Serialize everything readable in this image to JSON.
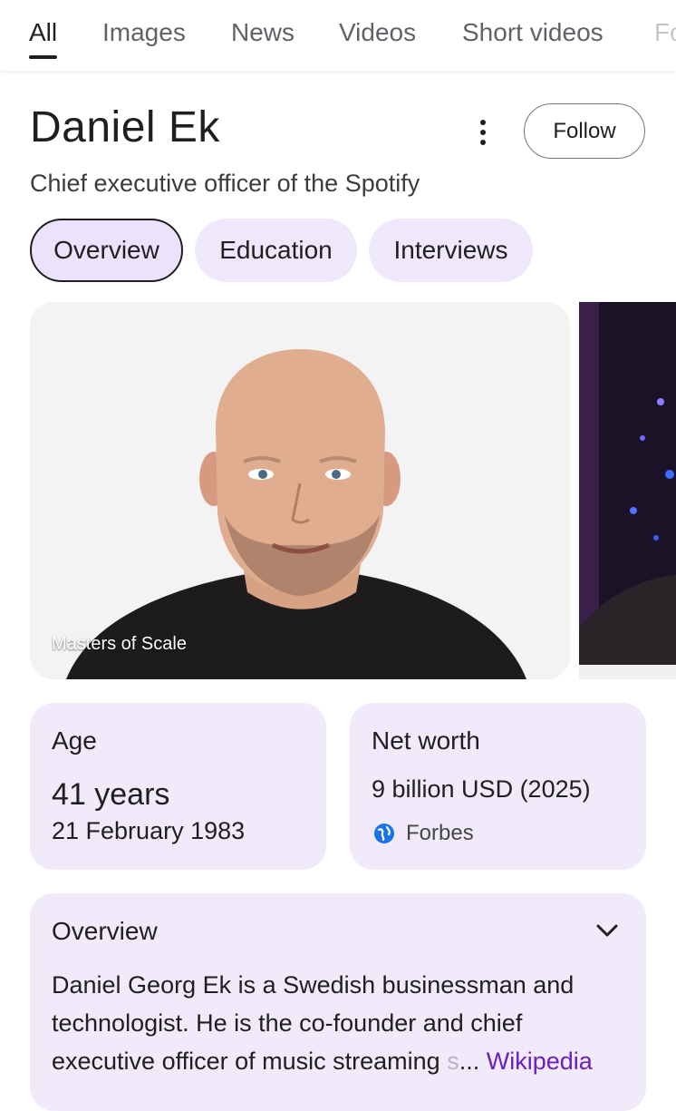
{
  "tabs": [
    {
      "label": "All",
      "active": true
    },
    {
      "label": "Images"
    },
    {
      "label": "News"
    },
    {
      "label": "Videos"
    },
    {
      "label": "Short videos"
    },
    {
      "label": "Fo"
    }
  ],
  "entity": {
    "name": "Daniel Ek",
    "subtitle": "Chief executive officer of the Spotify",
    "follow_label": "Follow",
    "more_icon": "more-vert-icon"
  },
  "chips": [
    {
      "label": "Overview",
      "selected": true
    },
    {
      "label": "Education"
    },
    {
      "label": "Interviews"
    }
  ],
  "images": {
    "main_credit": "Masters of Scale"
  },
  "age": {
    "label": "Age",
    "value": "41 years",
    "date": "21 February 1983"
  },
  "net_worth": {
    "label": "Net worth",
    "value": "9 billion USD (2025)",
    "source": "Forbes",
    "source_icon": "globe-icon"
  },
  "overview": {
    "label": "Overview",
    "text": "Daniel Georg Ek is a Swedish businessman and technologist. He is the co-founder and chief executive officer of music streaming",
    "faded": "s",
    "ellipsis": "...",
    "link": "Wikipedia",
    "expand_icon": "chevron-down-icon"
  },
  "colors": {
    "accent_chip": "#efe7fb",
    "card_bg": "#f1eafa",
    "link": "#6a1fc2",
    "globe": "#1a73e8"
  }
}
